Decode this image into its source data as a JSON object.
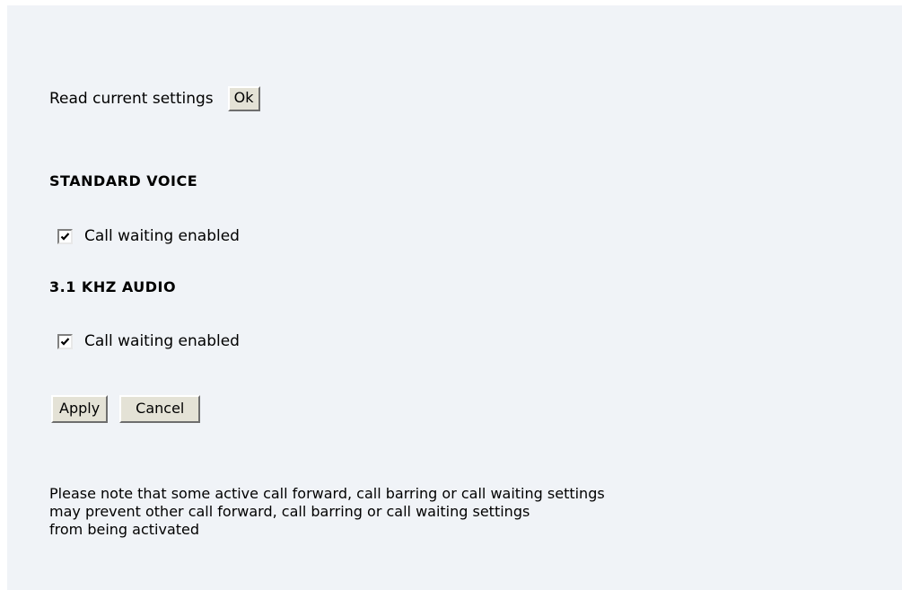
{
  "read_settings": {
    "label": "Read current settings",
    "ok_button": "Ok"
  },
  "sections": [
    {
      "title": "STANDARD VOICE",
      "checkbox_label": "Call waiting enabled",
      "checked": true
    },
    {
      "title": "3.1 KHZ AUDIO",
      "checkbox_label": "Call waiting enabled",
      "checked": true
    }
  ],
  "actions": {
    "apply": "Apply",
    "cancel": "Cancel"
  },
  "note": {
    "lines": [
      "Please note that some active call forward, call barring or call waiting settings",
      "may prevent other call forward, call barring or call waiting settings",
      "from being activated"
    ]
  },
  "icons": {
    "checkbox_checked": "check-mark-icon"
  }
}
